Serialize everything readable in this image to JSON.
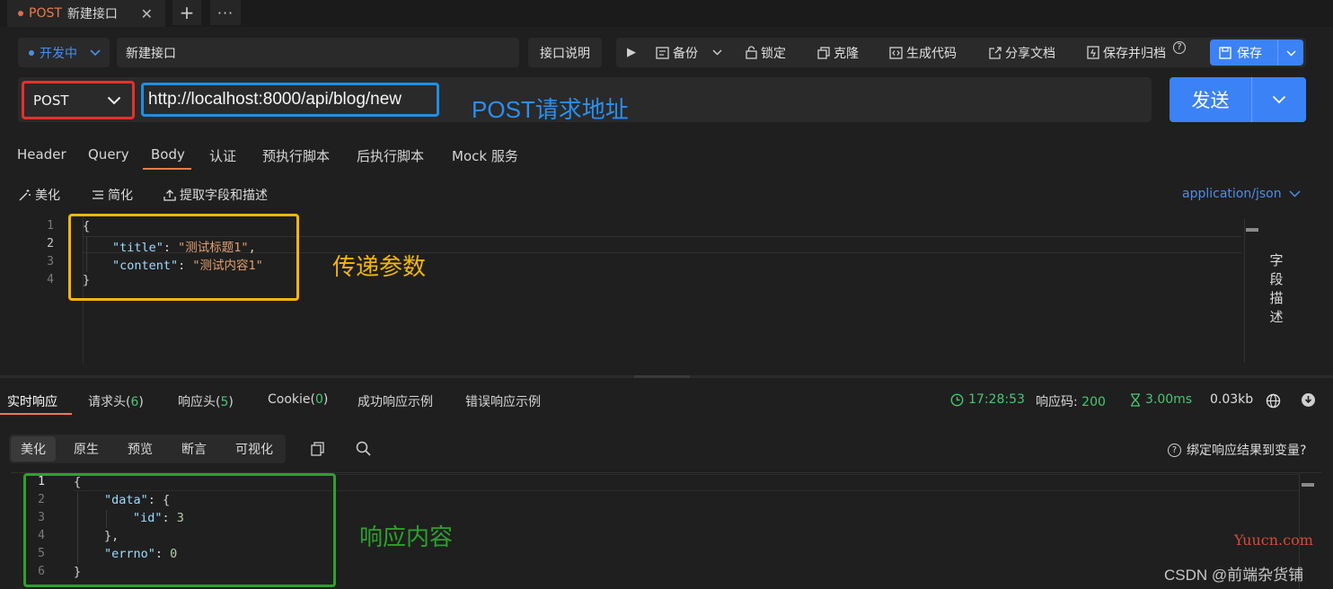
{
  "tab": {
    "method": "POST",
    "name": "新建接口",
    "close": "✕",
    "plus": "+",
    "more": "···"
  },
  "toolbar": {
    "status": "开发中",
    "name_value": "新建接口",
    "desc_button": "接口说明",
    "actions": {
      "run": "▶",
      "backup": "备份",
      "lock": "锁定",
      "clone": "克隆",
      "gen_code": "生成代码",
      "share_doc": "分享文档",
      "save_archive": "保存并归档",
      "help": "?",
      "save": "保存"
    }
  },
  "request": {
    "method": "POST",
    "url": "http://localhost:8000/api/blog/new",
    "url_note": "POST请求地址",
    "send": "发送",
    "tabs": [
      "Header",
      "Query",
      "Body",
      "认证",
      "预执行脚本",
      "后执行脚本",
      "Mock 服务"
    ],
    "active_tab": "Body",
    "body_tools": {
      "beautify": "美化",
      "simplify": "简化",
      "extract": "提取字段和描述"
    },
    "content_type": "application/json",
    "body_note": "传递参数",
    "field_desc": [
      "字",
      "段",
      "描",
      "述"
    ],
    "body_lines": [
      {
        "n": "1",
        "open": "{"
      },
      {
        "n": "2",
        "key": "\"title\"",
        "value": "\"测试标题1\"",
        "comma": ","
      },
      {
        "n": "3",
        "key": "\"content\"",
        "value": "\"测试内容1\""
      },
      {
        "n": "4",
        "close": "}"
      }
    ]
  },
  "response": {
    "tabs": {
      "realtime": "实时响应",
      "req_headers": "请求头",
      "req_headers_count": "6",
      "res_headers": "响应头",
      "res_headers_count": "5",
      "cookie": "Cookie",
      "cookie_count": "0",
      "success_example": "成功响应示例",
      "error_example": "错误响应示例"
    },
    "time": "17:28:53",
    "code_label": "响应码:",
    "code": "200",
    "duration": "3.00ms",
    "size": "0.03kb",
    "view_modes": [
      "美化",
      "原生",
      "预览",
      "断言",
      "可视化"
    ],
    "active_mode": "美化",
    "bind_help": "绑定响应结果到变量?",
    "note": "响应内容",
    "line_numbers": [
      "1",
      "2",
      "3",
      "4",
      "5",
      "6"
    ],
    "json": {
      "l1": "{",
      "data_key": "\"data\"",
      "l2_tail": ": {",
      "id_key": "\"id\"",
      "id_sep": ": ",
      "id_val": "3",
      "l4": "},",
      "errno_key": "\"errno\"",
      "errno_sep": ": ",
      "errno_val": "0",
      "l6": "}"
    }
  },
  "colors": {
    "accent": "#3b82f6",
    "orange": "#ef7b4a",
    "green": "#48c774",
    "red_box": "#e8302c",
    "blue_box": "#1e90e6",
    "yellow_box": "#f3b60b",
    "green_box": "#2ca12c"
  },
  "watermarks": {
    "yuucn": "Yuucn.com",
    "csdn": "CSDN @前端杂货铺"
  }
}
